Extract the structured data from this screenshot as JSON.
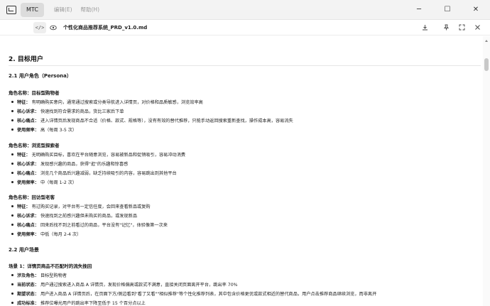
{
  "window": {
    "app_name": "MTC",
    "menu": [
      "编辑(E)",
      "帮助(H)"
    ],
    "controls": [
      "─",
      "☐",
      "✕"
    ]
  },
  "file": {
    "code_label": "</>",
    "name": "个性化商品推荐系统_PRD_v1.0.md"
  },
  "doc": {
    "section": "2. 目标用户",
    "sub1": "2.1 用户角色（Persona）",
    "personas": [
      {
        "title": "角色名称：目标型购物者",
        "items": [
          {
            "k": "特征：",
            "v": "有明确购买意向，通常通过搜索或分类导航进入详情页，对价格和品质敏感，浏览效率高"
          },
          {
            "k": "核心诉求：",
            "v": "快速找到符合需求的商品，货比三家后下单"
          },
          {
            "k": "核心痛点：",
            "v": "进入详情页后发现商品不合适（价格、款式、规格等），没有有效的替代推荐，只能手动返回搜索重新查找，操作成本高，容易流失"
          },
          {
            "k": "使用频率：",
            "v": "高（每周 3-5 次）"
          }
        ]
      },
      {
        "title": "角色名称：浏览型探索者",
        "items": [
          {
            "k": "特征：",
            "v": "无明确购买目标，喜欢在平台随意浏览，容易被新品和促销吸引，容易冲动消费"
          },
          {
            "k": "核心诉求：",
            "v": "发现感兴趣的商品，获得\"逛\"的乐趣和惊喜感"
          },
          {
            "k": "核心痛点：",
            "v": "浏览几个商品后兴趣减弱，缺乏持续吸引的内容，容易跳出到其他平台"
          },
          {
            "k": "使用频率：",
            "v": "中（每周 1-2 次）"
          }
        ]
      },
      {
        "title": "角色名称：回访型老客",
        "items": [
          {
            "k": "特征：",
            "v": "有过购买记录，对平台有一定信任度，会回来查看新品或复购"
          },
          {
            "k": "核心诉求：",
            "v": "快速找到之前感兴趣但未购买的商品，或发现新品"
          },
          {
            "k": "核心痛点：",
            "v": "回来后找不到之前看过的商品，平台没有\"记忆\"，体验像第一次来"
          },
          {
            "k": "使用频率：",
            "v": "中低（每月 2-4 次）"
          }
        ]
      }
    ],
    "sub2": "2.2 用户场景",
    "scenario": {
      "title": "场景 1：详情页商品不匹配时的流失挽回",
      "items": [
        {
          "k": "涉及角色：",
          "v": "目标型购物者"
        },
        {
          "k": "当前状态：",
          "v": "用户通过搜索进入商品 A 详情页，发现价格偏高或款式不满意，直接关闭页面离开平台，跳出率 70%"
        },
        {
          "k": "期望状态：",
          "v": "用户进入商品 A 详情页后，在页面下方/侧边看到\"看了又看\"\"相似推荐\"等个性化推荐列表，其中包含价格更优或款式相近的替代商品，用户点击推荐商品继续浏览，而非离开"
        },
        {
          "k": "成功标准：",
          "v": "推荐位曝光用户的跳出率下降至低于 15 个百分点以上"
        }
      ]
    }
  }
}
